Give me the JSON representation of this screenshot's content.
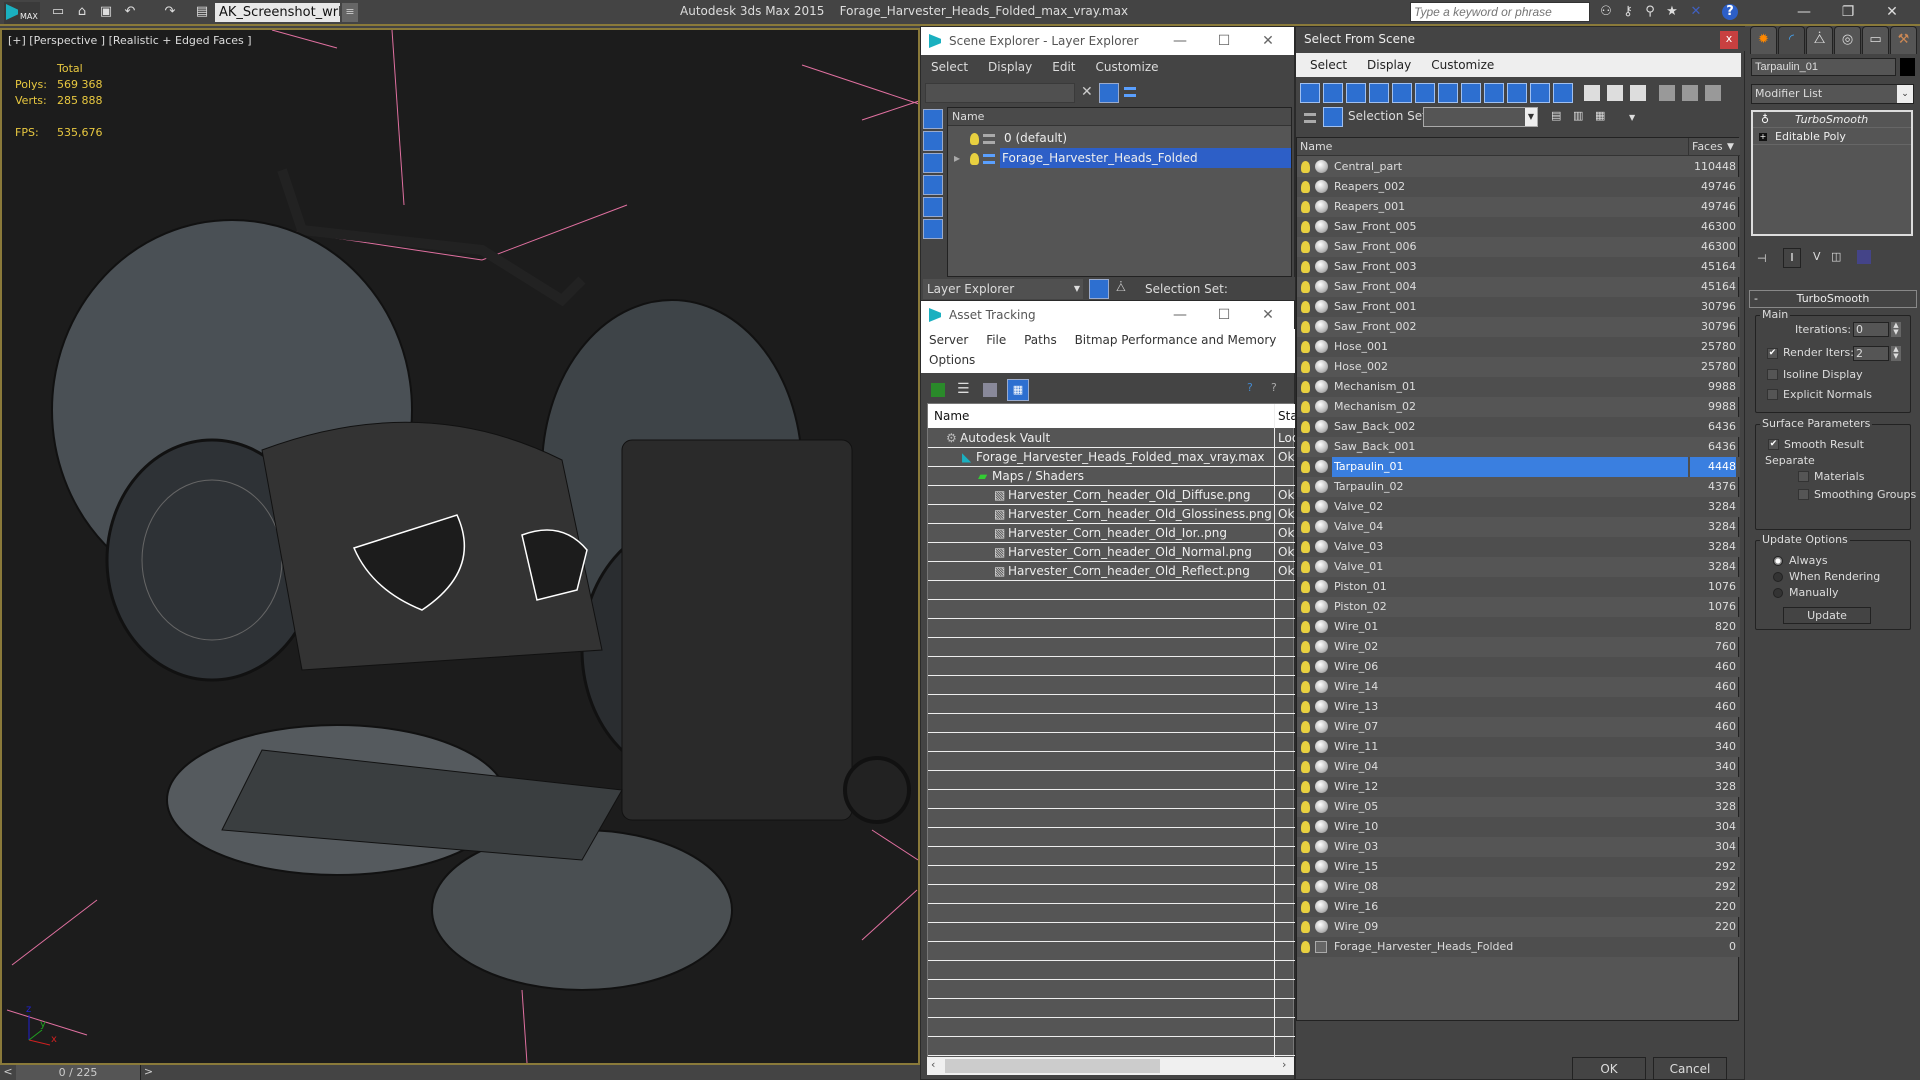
{
  "topbar": {
    "logo_text": "MAX",
    "workspace": "AK_Screenshot_wrksp",
    "app_title": "Autodesk 3ds Max  2015",
    "file_title": "Forage_Harvester_Heads_Folded_max_vray.max",
    "search_placeholder": "Type a keyword or phrase",
    "icons": [
      "new-file-icon",
      "open-file-icon",
      "save-icon",
      "undo-icon",
      "redo-icon",
      "project-folder-icon"
    ],
    "right_icons": [
      "binoculars-icon",
      "key-icon",
      "satellite-icon",
      "star-icon",
      "x-icon",
      "help-icon"
    ]
  },
  "viewport": {
    "label": "[+] [Perspective ] [Realistic + Edged Faces ]",
    "stats": {
      "header": "Total",
      "polys_label": "Polys:",
      "polys": "569 368",
      "verts_label": "Verts:",
      "verts": "285 888",
      "fps_label": "FPS:",
      "fps": "535,676"
    },
    "axis": {
      "x": "x",
      "y": "y",
      "z": "z"
    }
  },
  "timeline": {
    "frame": "0 / 225",
    "prev": "<",
    "next": ">"
  },
  "scene_explorer": {
    "title": "Scene Explorer - Layer Explorer",
    "menu": [
      "Select",
      "Display",
      "Edit",
      "Customize"
    ],
    "col_name": "Name",
    "layers": [
      {
        "name": "0 (default)",
        "selected": false
      },
      {
        "name": "Forage_Harvester_Heads_Folded",
        "selected": true
      }
    ],
    "bottom_dropdown": "Layer Explorer",
    "selection_set_label": "Selection Set:"
  },
  "asset_tracking": {
    "title": "Asset Tracking",
    "menu_row1": [
      "Server",
      "File",
      "Paths",
      "Bitmap Performance and Memory"
    ],
    "menu_row2": [
      "Options"
    ],
    "col_name": "Name",
    "col_status": "Sta",
    "rows": [
      {
        "name": "Autodesk Vault",
        "status": "Loc",
        "indent": 1,
        "icon": "vault-icon"
      },
      {
        "name": "Forage_Harvester_Heads_Folded_max_vray.max",
        "status": "Ok",
        "indent": 2,
        "icon": "max-file-icon"
      },
      {
        "name": "Maps / Shaders",
        "status": "",
        "indent": 3,
        "icon": "maps-icon"
      },
      {
        "name": "Harvester_Corn_header_Old_Diffuse.png",
        "status": "Ok",
        "indent": 4,
        "icon": "bitmap-icon"
      },
      {
        "name": "Harvester_Corn_header_Old_Glossiness.png",
        "status": "Ok",
        "indent": 4,
        "icon": "bitmap-icon"
      },
      {
        "name": "Harvester_Corn_header_Old_Ior..png",
        "status": "Ok",
        "indent": 4,
        "icon": "bitmap-icon"
      },
      {
        "name": "Harvester_Corn_header_Old_Normal.png",
        "status": "Ok",
        "indent": 4,
        "icon": "bitmap-icon"
      },
      {
        "name": "Harvester_Corn_header_Old_Reflect.png",
        "status": "Ok",
        "indent": 4,
        "icon": "bitmap-icon"
      }
    ]
  },
  "select_from_scene": {
    "title": "Select From Scene",
    "close": "x",
    "menu": [
      "Select",
      "Display",
      "Customize"
    ],
    "selection_set_label": "Selection Set:",
    "col_name": "Name",
    "col_faces": "Faces",
    "objects": [
      {
        "name": "Central_part",
        "faces": "110448"
      },
      {
        "name": "Reapers_002",
        "faces": "49746"
      },
      {
        "name": "Reapers_001",
        "faces": "49746"
      },
      {
        "name": "Saw_Front_005",
        "faces": "46300"
      },
      {
        "name": "Saw_Front_006",
        "faces": "46300"
      },
      {
        "name": "Saw_Front_003",
        "faces": "45164"
      },
      {
        "name": "Saw_Front_004",
        "faces": "45164"
      },
      {
        "name": "Saw_Front_001",
        "faces": "30796"
      },
      {
        "name": "Saw_Front_002",
        "faces": "30796"
      },
      {
        "name": "Hose_001",
        "faces": "25780"
      },
      {
        "name": "Hose_002",
        "faces": "25780"
      },
      {
        "name": "Mechanism_01",
        "faces": "9988"
      },
      {
        "name": "Mechanism_02",
        "faces": "9988"
      },
      {
        "name": "Saw_Back_002",
        "faces": "6436"
      },
      {
        "name": "Saw_Back_001",
        "faces": "6436"
      },
      {
        "name": "Tarpaulin_01",
        "faces": "4448",
        "selected": true
      },
      {
        "name": "Tarpaulin_02",
        "faces": "4376"
      },
      {
        "name": "Valve_02",
        "faces": "3284"
      },
      {
        "name": "Valve_04",
        "faces": "3284"
      },
      {
        "name": "Valve_03",
        "faces": "3284"
      },
      {
        "name": "Valve_01",
        "faces": "3284"
      },
      {
        "name": "Piston_01",
        "faces": "1076"
      },
      {
        "name": "Piston_02",
        "faces": "1076"
      },
      {
        "name": "Wire_01",
        "faces": "820"
      },
      {
        "name": "Wire_02",
        "faces": "760"
      },
      {
        "name": "Wire_06",
        "faces": "460"
      },
      {
        "name": "Wire_14",
        "faces": "460"
      },
      {
        "name": "Wire_13",
        "faces": "460"
      },
      {
        "name": "Wire_07",
        "faces": "460"
      },
      {
        "name": "Wire_11",
        "faces": "340"
      },
      {
        "name": "Wire_04",
        "faces": "340"
      },
      {
        "name": "Wire_12",
        "faces": "328"
      },
      {
        "name": "Wire_05",
        "faces": "328"
      },
      {
        "name": "Wire_10",
        "faces": "304"
      },
      {
        "name": "Wire_03",
        "faces": "304"
      },
      {
        "name": "Wire_15",
        "faces": "292"
      },
      {
        "name": "Wire_08",
        "faces": "292"
      },
      {
        "name": "Wire_16",
        "faces": "220"
      },
      {
        "name": "Wire_09",
        "faces": "220"
      },
      {
        "name": "Forage_Harvester_Heads_Folded",
        "faces": "0",
        "group": true
      }
    ],
    "ok": "OK",
    "cancel": "Cancel"
  },
  "command_panel": {
    "tabs": [
      "create-tab",
      "modify-tab",
      "hierarchy-tab",
      "motion-tab",
      "display-tab",
      "utilities-tab"
    ],
    "object_name": "Tarpaulin_01",
    "object_color": "#000000",
    "modifier_list": "Modifier List",
    "stack": [
      "TurboSmooth",
      "Editable Poly"
    ],
    "turbosmooth": {
      "title": "TurboSmooth",
      "main_label": "Main",
      "iterations_label": "Iterations:",
      "iterations": "0",
      "render_iters_label": "Render Iters:",
      "render_iters": "2",
      "render_iters_checked": true,
      "isoline_label": "Isoline Display",
      "isoline_checked": false,
      "explicit_label": "Explicit Normals",
      "explicit_checked": false,
      "surface_label": "Surface Parameters",
      "smooth_result_label": "Smooth Result",
      "smooth_result_checked": true,
      "separate_label": "Separate",
      "materials_label": "Materials",
      "materials_checked": false,
      "smoothing_groups_label": "Smoothing Groups",
      "smoothing_groups_checked": false,
      "update_options_label": "Update Options",
      "always_label": "Always",
      "when_rendering_label": "When Rendering",
      "manually_label": "Manually",
      "update_selected": "Always",
      "update_button": "Update"
    }
  }
}
